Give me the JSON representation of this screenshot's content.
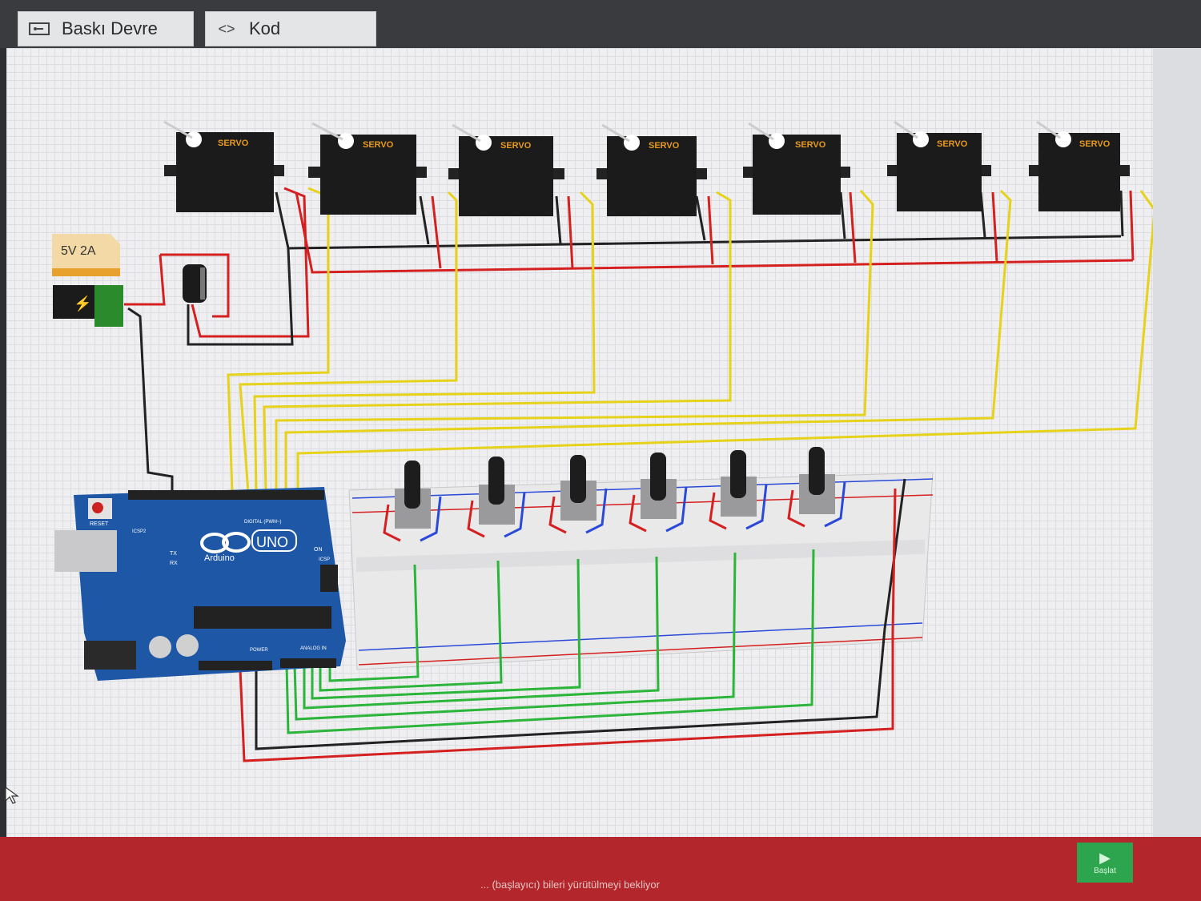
{
  "tabs": [
    {
      "label": "Baskı Devre",
      "icon": "circuit-board-icon"
    },
    {
      "label": "Kod",
      "icon": "code-brackets-icon"
    }
  ],
  "power_supply": {
    "label": "5V 2A"
  },
  "servo_label": "SERVO",
  "arduino": {
    "brand": "Arduino",
    "model": "UNO",
    "reset_label": "RESET",
    "digital_label": "DIGITAL (PWM~)",
    "analog_label": "ANALOG IN",
    "power_label": "POWER",
    "on_label": "ON",
    "tx_label": "TX",
    "rx_label": "RX",
    "icsp_label": "ICSP",
    "icsp2_label": "ICSP2"
  },
  "status_bar": {
    "text": "... (başlayıcı) bileri yürütülmeyi bekliyor"
  },
  "start_button": {
    "label": "Başlat"
  },
  "colors": {
    "wire_red": "#d42020",
    "wire_black": "#222222",
    "wire_yellow": "#e6d21a",
    "wire_green": "#2bb53a",
    "wire_blue": "#2a49d8",
    "arduino_blue": "#1e57a6"
  }
}
